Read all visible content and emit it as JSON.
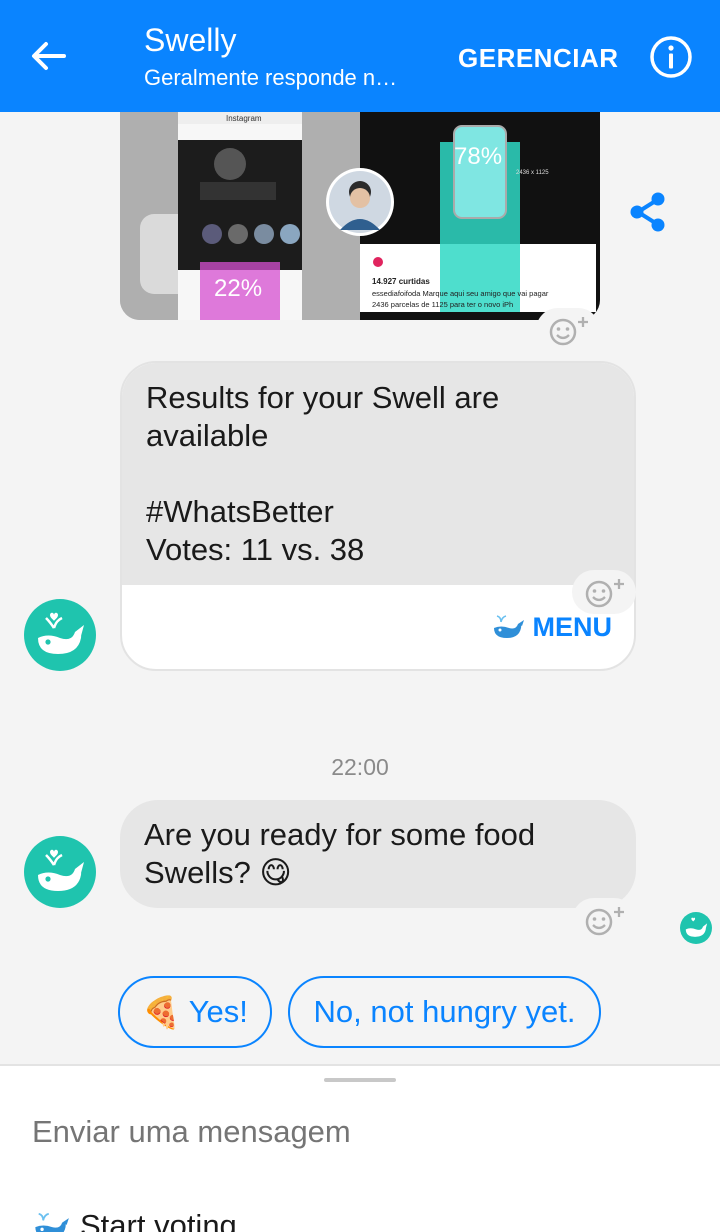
{
  "colors": {
    "accent": "#0a84ff",
    "bot_avatar": "#1fc4ae",
    "bubble": "#e6e6e6"
  },
  "header": {
    "title": "Swelly",
    "subtitle": "Geralmente responde n…",
    "manage_label": "GERENCIAR",
    "back_icon": "arrow-left-icon",
    "info_icon": "info-icon"
  },
  "image_card": {
    "app_label": "Instagram",
    "left_percent": "22%",
    "right_percent": "78%",
    "likes": "14.927 curtidas",
    "caption_line1": "essediafoifoda Marque aqui seu amigo que vai pagar",
    "caption_line2": "2436 parcelas de 1125 para ter o novo iPh",
    "spec_label": "2436 x 1125"
  },
  "result_card": {
    "line1": "Results for your Swell are",
    "line2": "available",
    "line3": "",
    "line4": "#WhatsBetter",
    "line5": "Votes: 11 vs. 38",
    "menu_label": "MENU"
  },
  "timestamp": "22:00",
  "message": {
    "line1": "Are you ready for some food",
    "line2": "Swells?",
    "emoji": "😋"
  },
  "quick_replies": {
    "yes": {
      "emoji": "🍕",
      "label": "Yes!"
    },
    "no": {
      "label": "No, not hungry yet."
    }
  },
  "composer": {
    "placeholder": "Enviar uma mensagem",
    "persistent_item": "Start voting"
  }
}
